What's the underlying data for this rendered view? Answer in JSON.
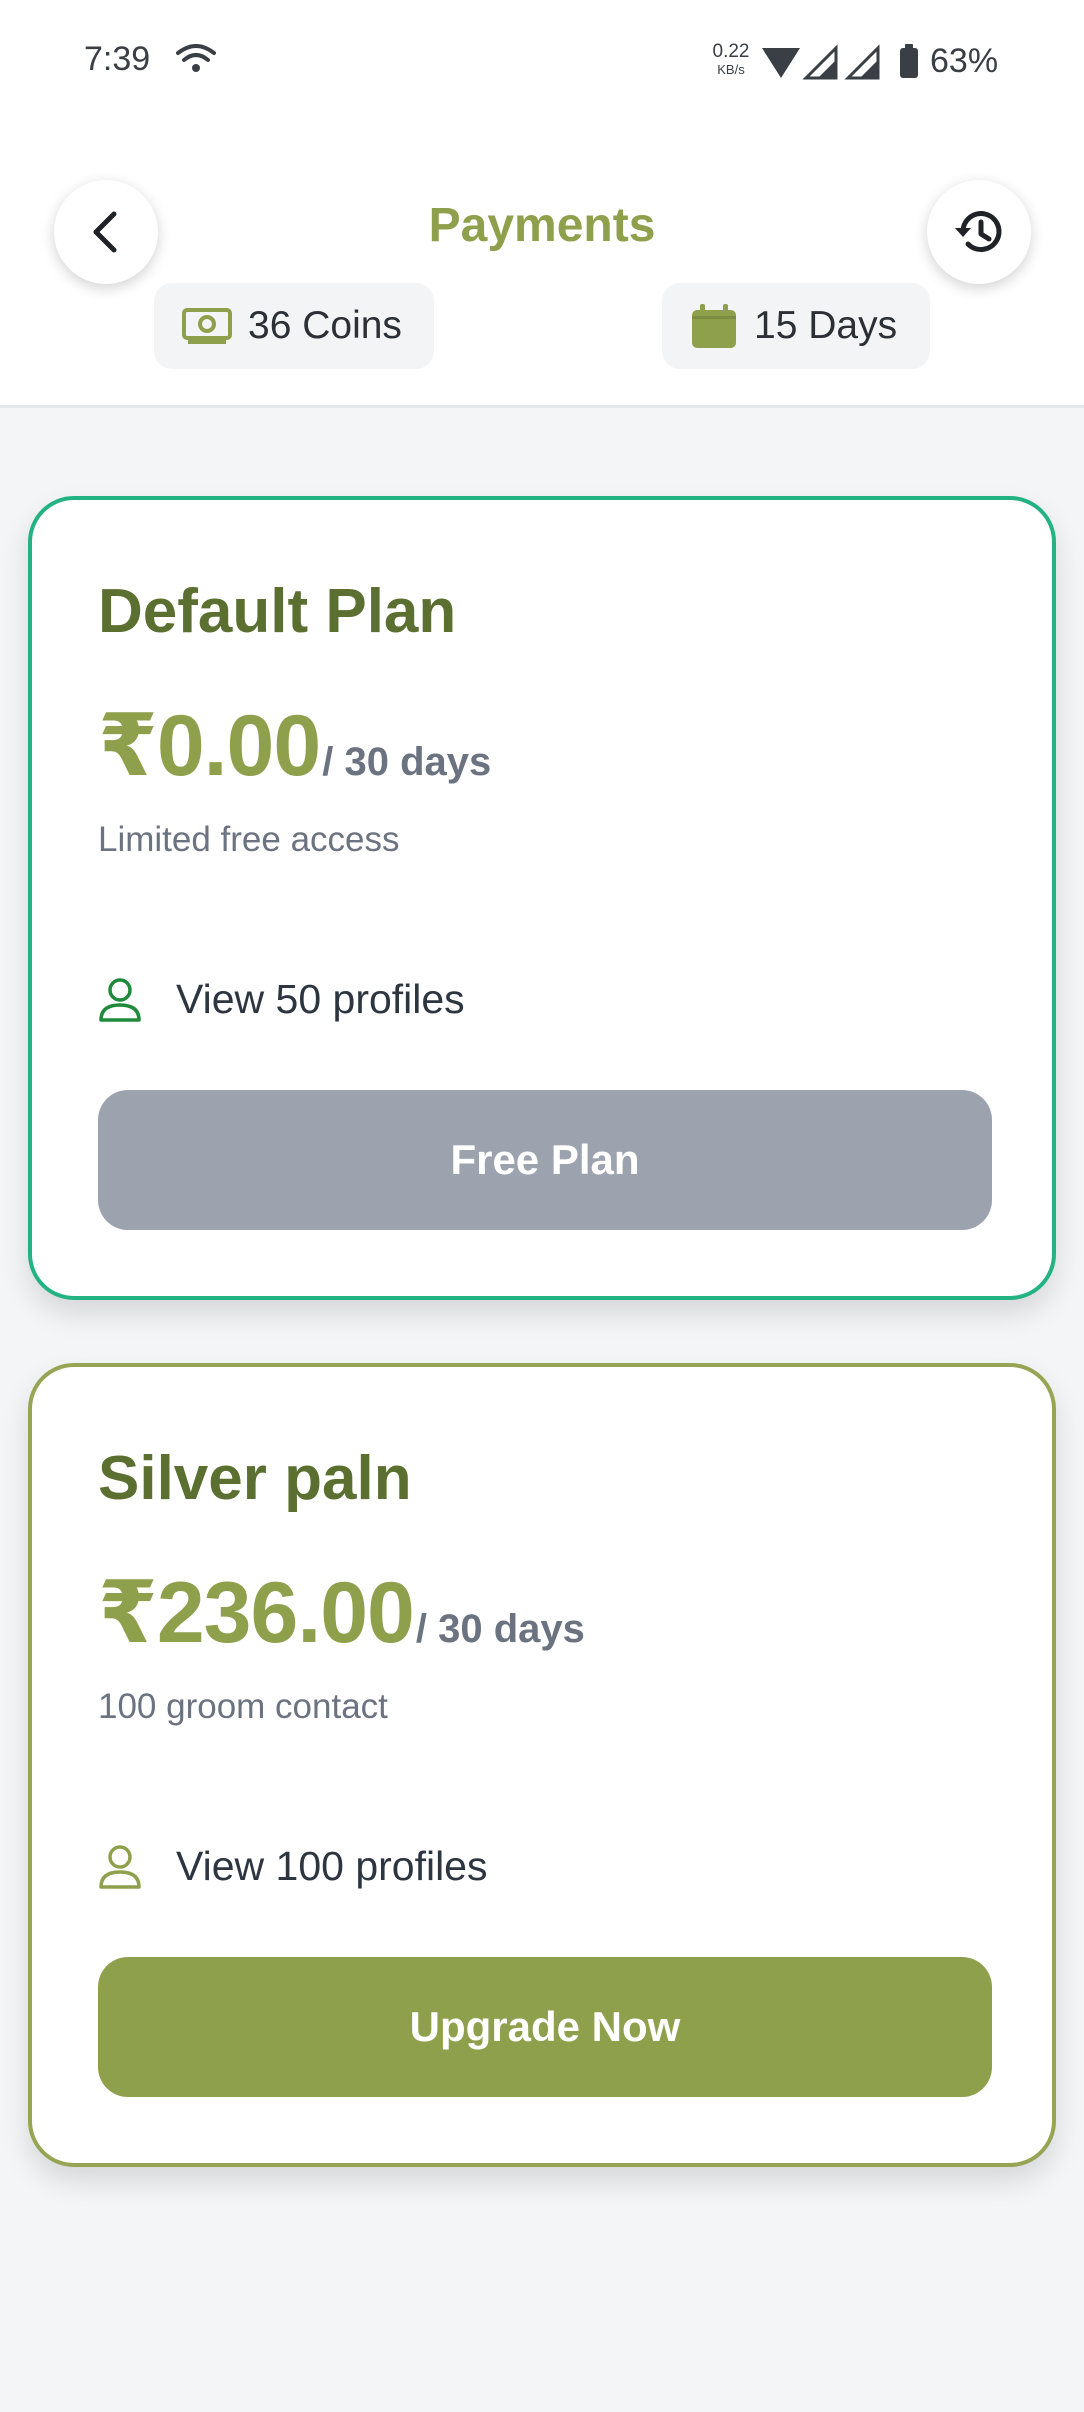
{
  "status_bar": {
    "time": "7:39",
    "net_speed_value": "0.22",
    "net_speed_unit": "KB/s",
    "battery": "63%"
  },
  "header": {
    "title": "Payments",
    "back_icon": "chevron-left-icon",
    "history_icon": "history-icon",
    "coins_label": "36 Coins",
    "days_label": "15 Days"
  },
  "plans": [
    {
      "name": "Default Plan",
      "price": "₹0.00",
      "period": "/ 30 days",
      "description": "Limited free access",
      "feature": "View 50 profiles",
      "button": "Free Plan",
      "border_color": "#23b383"
    },
    {
      "name": "Silver paln",
      "price": "₹236.00",
      "period": "/ 30 days",
      "description": "100 groom contact",
      "feature": "View 100 profiles",
      "button": "Upgrade Now",
      "border_color": "#96a453"
    }
  ],
  "colors": {
    "accent": "#8fa04d",
    "heading": "#5b7030",
    "active_border": "#23b383",
    "disabled_button": "#9ca3af"
  }
}
